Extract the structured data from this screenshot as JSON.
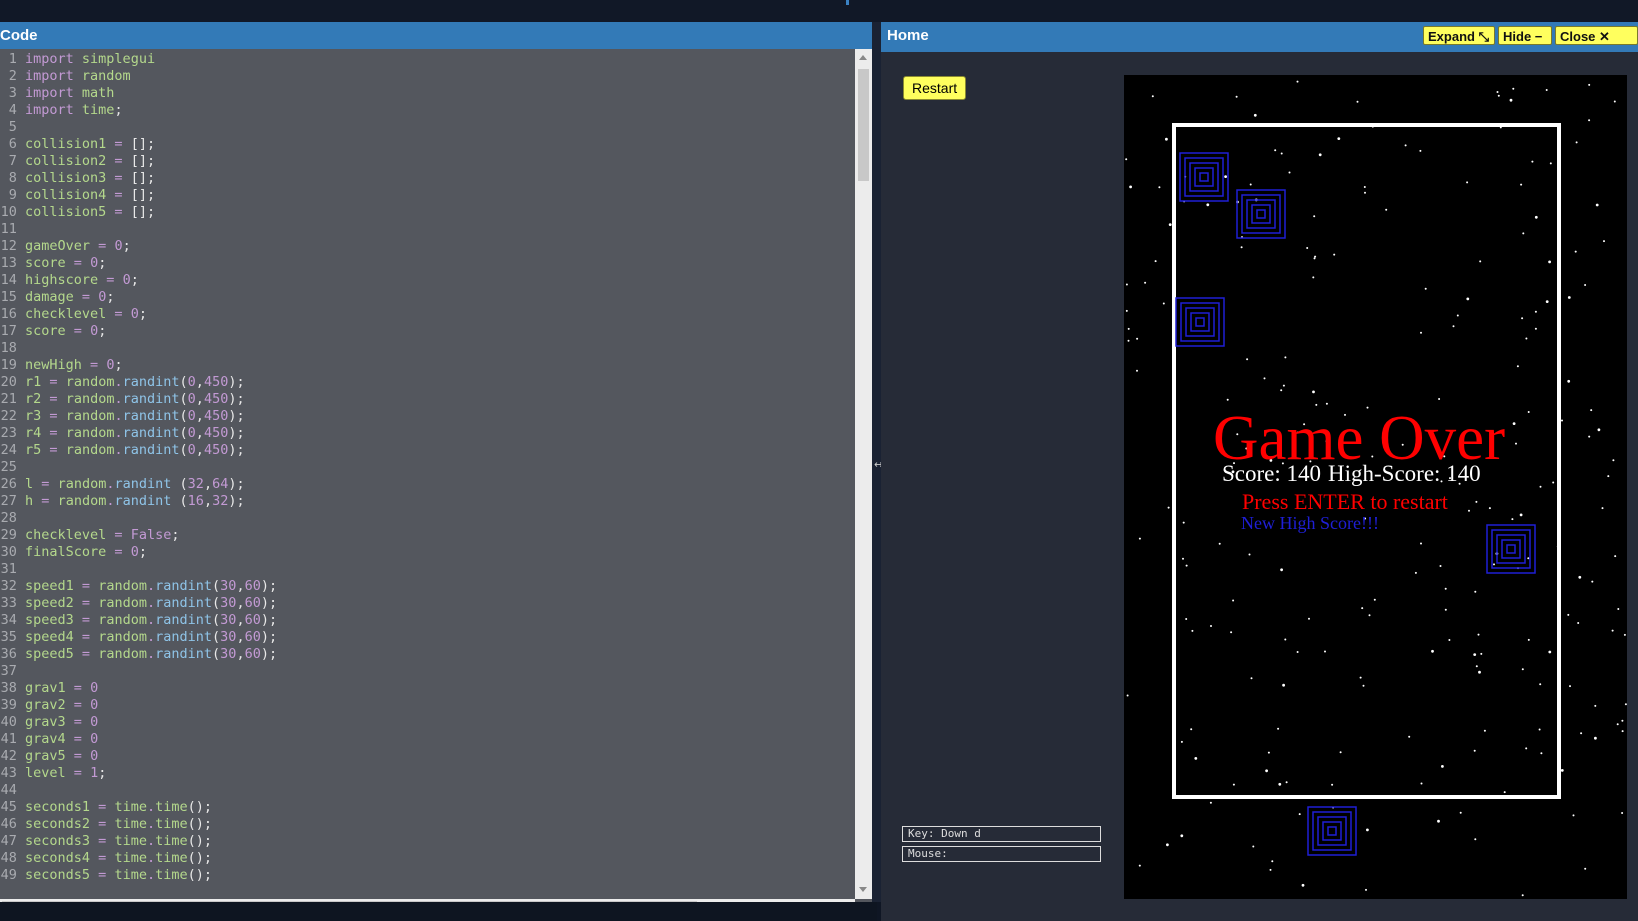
{
  "code_panel": {
    "title": "Code",
    "lines": [
      "import simplegui",
      "import random",
      "import math",
      "import time;",
      "",
      "collision1 = [];",
      "collision2 = [];",
      "collision3 = [];",
      "collision4 = [];",
      "collision5 = [];",
      "",
      "gameOver = 0;",
      "score = 0;",
      "highscore = 0;",
      "damage = 0;",
      "checklevel = 0;",
      "score = 0;",
      "",
      "newHigh = 0;",
      "r1 = random.randint(0,450);",
      "r2 = random.randint(0,450);",
      "r3 = random.randint(0,450);",
      "r4 = random.randint(0,450);",
      "r5 = random.randint(0,450);",
      "",
      "l = random.randint (32,64);",
      "h = random.randint (16,32);",
      "",
      "checklevel = False;",
      "finalScore = 0;",
      "",
      "speed1 = random.randint(30,60);",
      "speed2 = random.randint(30,60);",
      "speed3 = random.randint(30,60);",
      "speed4 = random.randint(30,60);",
      "speed5 = random.randint(30,60);",
      "",
      "grav1 = 0",
      "grav2 = 0",
      "grav3 = 0",
      "grav4 = 0",
      "grav5 = 0",
      "level = 1;",
      "",
      "seconds1 = time.time();",
      "seconds2 = time.time();",
      "seconds3 = time.time();",
      "seconds4 = time.time();",
      "seconds5 = time.time();"
    ]
  },
  "home_panel": {
    "title": "Home",
    "buttons": {
      "expand": "Expand ⤡",
      "hide": "Hide −",
      "close": "Close ✕"
    },
    "restart_label": "Restart",
    "key_status": "Key: Down d",
    "mouse_status": "Mouse:"
  },
  "game": {
    "game_over_text": "Game Over",
    "score_text": "Score: 140",
    "high_score_text": "High-Score: 140",
    "restart_prompt": "Press ENTER to restart",
    "new_high_text": "New High Score!!!",
    "colors": {
      "red": "#ff0000",
      "blue": "#1f1fd6",
      "white": "#ffffff",
      "background": "#000000"
    }
  }
}
